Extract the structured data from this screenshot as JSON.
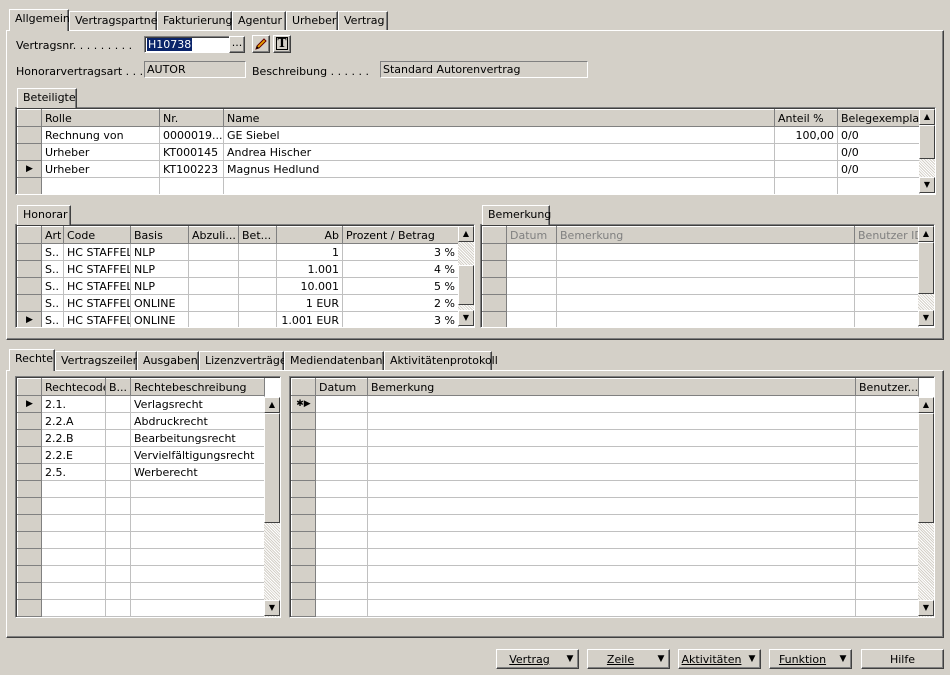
{
  "top_tabs": [
    "Allgemein",
    "Vertragspartner",
    "Fakturierung",
    "Agentur",
    "Urheber",
    "Vertrag"
  ],
  "header": {
    "vertragsnr_label": "Vertragsnr. . . . . . . . .",
    "vertragsnr_value": "H10738",
    "lookup_btn": "...",
    "honorarvertragsart_label": "Honorarvertragsart . . .",
    "honorarvertragsart_value": "AUTOR",
    "beschreibung_label": "Beschreibung . . . . . .",
    "beschreibung_value": "Standard Autorenvertrag"
  },
  "beteiligte": {
    "tab": "Beteiligte",
    "columns": [
      "Rolle",
      "Nr.",
      "Name",
      "Anteil %",
      "Belegexemplare"
    ],
    "rows": [
      {
        "marker": "",
        "rolle": "Rechnung von",
        "nr": "0000019...",
        "name": "GE Siebel",
        "anteil": "100,00",
        "beleg": "0/0"
      },
      {
        "marker": "",
        "rolle": "Urheber",
        "nr": "KT000145",
        "name": "Andrea Hischer",
        "anteil": "",
        "beleg": "0/0"
      },
      {
        "marker": "▶",
        "rolle": "Urheber",
        "nr": "KT100223",
        "name": "Magnus Hedlund",
        "anteil": "",
        "beleg": "0/0"
      },
      {
        "marker": "",
        "rolle": "",
        "nr": "",
        "name": "",
        "anteil": "",
        "beleg": ""
      }
    ]
  },
  "honorar": {
    "tab": "Honorar",
    "columns": [
      "Art",
      "Code",
      "Basis",
      "Abzuli...",
      "Bet...",
      "Ab",
      "Prozent / Betrag"
    ],
    "rows": [
      {
        "marker": "",
        "art": "S..",
        "code": "HC STAFFEL",
        "basis": "NLP",
        "abz": "",
        "bet": "",
        "ab": "1",
        "proz": "3 %"
      },
      {
        "marker": "",
        "art": "S..",
        "code": "HC STAFFEL",
        "basis": "NLP",
        "abz": "",
        "bet": "",
        "ab": "1.001",
        "proz": "4 %"
      },
      {
        "marker": "",
        "art": "S..",
        "code": "HC STAFFEL",
        "basis": "NLP",
        "abz": "",
        "bet": "",
        "ab": "10.001",
        "proz": "5 %"
      },
      {
        "marker": "",
        "art": "S..",
        "code": "HC STAFFEL",
        "basis": "ONLINE",
        "abz": "",
        "bet": "",
        "ab": "1 EUR",
        "proz": "2 %"
      },
      {
        "marker": "▶",
        "art": "S..",
        "code": "HC STAFFEL",
        "basis": "ONLINE",
        "abz": "",
        "bet": "",
        "ab": "1.001 EUR",
        "proz": "3 %"
      }
    ]
  },
  "bemerkung": {
    "tab": "Bemerkung",
    "columns": [
      "Datum",
      "Bemerkung",
      "Benutzer ID"
    ]
  },
  "bottom_tabs": [
    "Rechte",
    "Vertragszeilen",
    "Ausgaben",
    "Lizenzverträge",
    "Mediendatenbank",
    "Aktivitätenprotokoll"
  ],
  "rechte": {
    "columns": [
      "Rechtecode",
      "B...",
      "Rechtebeschreibung"
    ],
    "rows": [
      {
        "marker": "▶",
        "code": "2.1.",
        "b": "",
        "desc": "Verlagsrecht"
      },
      {
        "marker": "",
        "code": "2.2.A",
        "b": "",
        "desc": "Abdruckrecht"
      },
      {
        "marker": "",
        "code": "2.2.B",
        "b": "",
        "desc": "Bearbeitungsrecht"
      },
      {
        "marker": "",
        "code": "2.2.E",
        "b": "",
        "desc": "Vervielfältigungsrecht"
      },
      {
        "marker": "",
        "code": "2.5.",
        "b": "",
        "desc": "Werberecht"
      }
    ]
  },
  "rechte_bemerkung": {
    "columns": [
      "Datum",
      "Bemerkung",
      "Benutzer..."
    ],
    "new_marker": "✱▶"
  },
  "buttons": {
    "vertrag": "Vertrag",
    "zeile": "Zeile",
    "aktivitaeten": "Aktivitäten",
    "funktion": "Funktion",
    "hilfe": "Hilfe"
  }
}
